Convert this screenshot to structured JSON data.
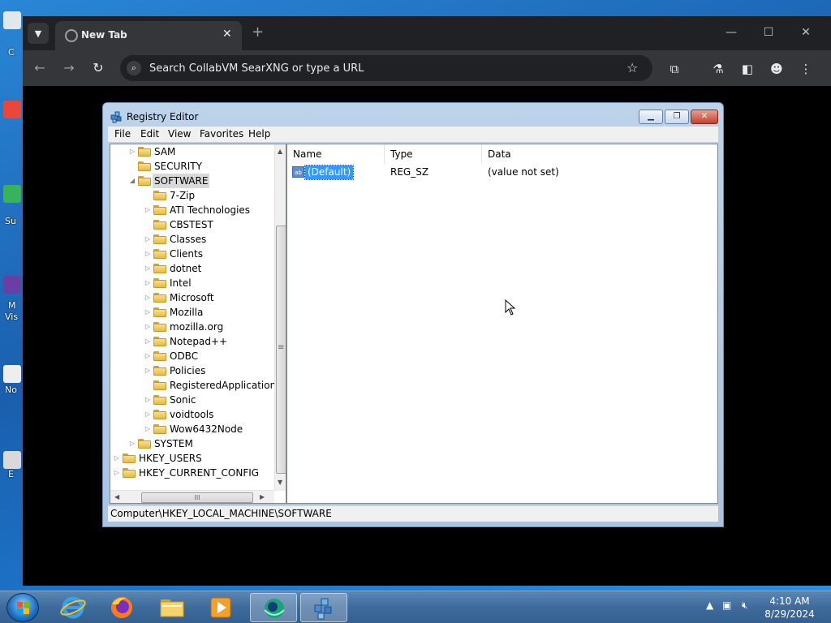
{
  "browser": {
    "tab_title": "New Tab",
    "tab_close": "✕",
    "new_tab": "+",
    "omnibox_placeholder": "Search CollabVM SearXNG or type a URL",
    "window_controls": {
      "minimize": "—",
      "maximize": "☐",
      "close": "✕"
    }
  },
  "desktop_labels": [
    "C",
    "Su",
    "M",
    "Vis",
    "No",
    "E"
  ],
  "regedit": {
    "title": "Registry Editor",
    "menu": [
      "File",
      "Edit",
      "View",
      "Favorites",
      "Help"
    ],
    "tree": [
      {
        "label": "SAM",
        "level": 1,
        "expander": "▷"
      },
      {
        "label": "SECURITY",
        "level": 1,
        "expander": ""
      },
      {
        "label": "SOFTWARE",
        "level": 1,
        "expander": "◢",
        "selected": true
      },
      {
        "label": "7-Zip",
        "level": 2,
        "expander": ""
      },
      {
        "label": "ATI Technologies",
        "level": 2,
        "expander": "▷"
      },
      {
        "label": "CBSTEST",
        "level": 2,
        "expander": ""
      },
      {
        "label": "Classes",
        "level": 2,
        "expander": "▷"
      },
      {
        "label": "Clients",
        "level": 2,
        "expander": "▷"
      },
      {
        "label": "dotnet",
        "level": 2,
        "expander": "▷"
      },
      {
        "label": "Intel",
        "level": 2,
        "expander": "▷"
      },
      {
        "label": "Microsoft",
        "level": 2,
        "expander": "▷"
      },
      {
        "label": "Mozilla",
        "level": 2,
        "expander": "▷"
      },
      {
        "label": "mozilla.org",
        "level": 2,
        "expander": "▷"
      },
      {
        "label": "Notepad++",
        "level": 2,
        "expander": "▷"
      },
      {
        "label": "ODBC",
        "level": 2,
        "expander": "▷"
      },
      {
        "label": "Policies",
        "level": 2,
        "expander": "▷"
      },
      {
        "label": "RegisteredApplications",
        "level": 2,
        "expander": ""
      },
      {
        "label": "Sonic",
        "level": 2,
        "expander": "▷"
      },
      {
        "label": "voidtools",
        "level": 2,
        "expander": "▷"
      },
      {
        "label": "Wow6432Node",
        "level": 2,
        "expander": "▷"
      },
      {
        "label": "SYSTEM",
        "level": 1,
        "expander": "▷"
      },
      {
        "label": "HKEY_USERS",
        "level": 0,
        "expander": "▷"
      },
      {
        "label": "HKEY_CURRENT_CONFIG",
        "level": 0,
        "expander": "▷"
      }
    ],
    "columns": {
      "name": "Name",
      "type": "Type",
      "data": "Data"
    },
    "values": [
      {
        "name": "(Default)",
        "type": "REG_SZ",
        "data": "(value not set)",
        "icon": "ab"
      }
    ],
    "scroll_grip": "≡",
    "hscroll_grip": "III",
    "status": "Computer\\HKEY_LOCAL_MACHINE\\SOFTWARE"
  },
  "taskbar": {
    "time": "4:10 AM",
    "date": "8/29/2024"
  }
}
